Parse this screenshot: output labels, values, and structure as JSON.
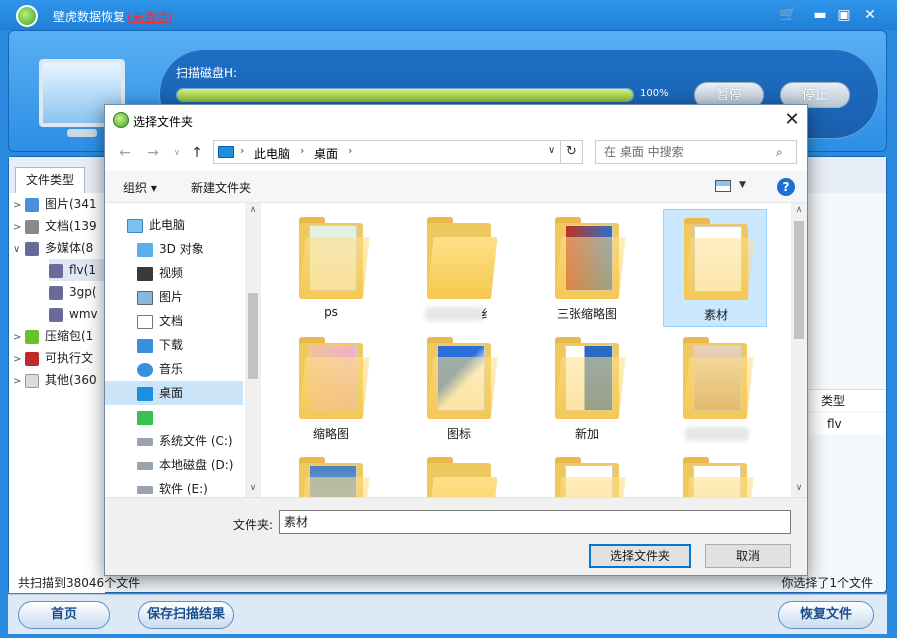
{
  "app": {
    "title": "壁虎数据恢复",
    "activation_status": "(未激活)"
  },
  "scan": {
    "label": "扫描磁盘H:",
    "progress": 100,
    "progress_text": "100%",
    "pause_label": "暂停",
    "stop_label": "停止"
  },
  "tree": {
    "tab_label": "文件类型",
    "items": [
      {
        "label": "图片(341"
      },
      {
        "label": "文档(139"
      },
      {
        "label": "多媒体(8"
      },
      {
        "label": "flv(1"
      },
      {
        "label": "3gp("
      },
      {
        "label": "wmv"
      },
      {
        "label": "压缩包(1"
      },
      {
        "label": "可执行文"
      },
      {
        "label": "其他(360"
      }
    ]
  },
  "list": {
    "type_header": "类型",
    "type_value": "flv"
  },
  "status": {
    "scanned_text": "共扫描到38046个文件",
    "selected_text": "你选择了1个文件"
  },
  "bottom": {
    "home_label": "首页",
    "save_label": "保存扫描结果",
    "restore_label": "恢复文件"
  },
  "dialog": {
    "title": "选择文件夹",
    "breadcrumb": [
      "此电脑",
      "桌面"
    ],
    "search_placeholder": "在 桌面 中搜索",
    "toolbar": {
      "organize_label": "组织 ▾",
      "new_folder_label": "新建文件夹"
    },
    "nav_items": [
      {
        "label": "此电脑"
      },
      {
        "label": "3D 对象"
      },
      {
        "label": "视频"
      },
      {
        "label": "图片"
      },
      {
        "label": "文档"
      },
      {
        "label": "下载"
      },
      {
        "label": "音乐"
      },
      {
        "label": "桌面"
      },
      {
        "label": ""
      },
      {
        "label": "系统文件 (C:)"
      },
      {
        "label": "本地磁盘 (D:)"
      },
      {
        "label": "软件 (E:)"
      }
    ],
    "folders": [
      {
        "label": "ps"
      },
      {
        "label": "纟"
      },
      {
        "label": "三张缩略图"
      },
      {
        "label": "素材"
      },
      {
        "label": "缩略图"
      },
      {
        "label": "图标"
      },
      {
        "label": "新加"
      },
      {
        "label": ""
      }
    ],
    "folder_field_label": "文件夹:",
    "folder_field_value": "素材",
    "select_button_label": "选择文件夹",
    "cancel_button_label": "取消"
  },
  "colors": {
    "title_bar": "#1f7fd6",
    "progress_fill": "#8dc43a",
    "activation_red": "#ff2a2a",
    "selection_blue": "#cce8ff"
  }
}
